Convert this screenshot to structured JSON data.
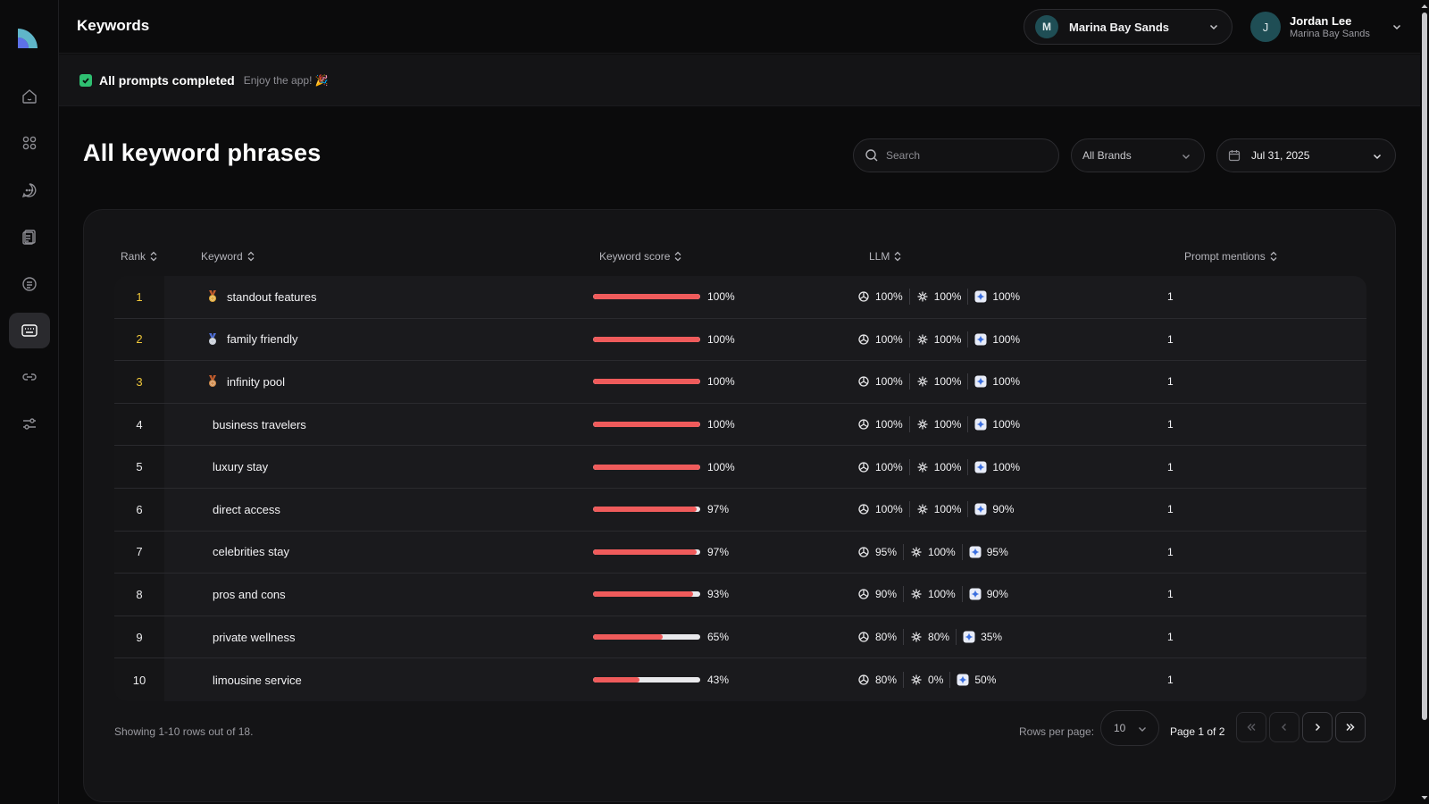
{
  "header": {
    "page_title": "Keywords",
    "brand": {
      "initial": "M",
      "name": "Marina Bay Sands"
    },
    "user": {
      "initial": "J",
      "name": "Jordan Lee",
      "org": "Marina Bay Sands"
    }
  },
  "banner": {
    "title": "All prompts completed",
    "subtitle": "Enjoy the app! 🎉"
  },
  "main": {
    "heading": "All keyword phrases",
    "search_placeholder": "Search",
    "brand_filter": "All Brands",
    "date_filter": "Jul 31, 2025"
  },
  "table": {
    "columns": {
      "rank": "Rank",
      "keyword": "Keyword",
      "score": "Keyword score",
      "llm": "LLM",
      "mentions": "Prompt mentions"
    },
    "rows": [
      {
        "rank": "1",
        "keyword": "standout features",
        "medal": "gold",
        "score": 100,
        "score_label": "100%",
        "llm": [
          "100%",
          "100%",
          "100%"
        ],
        "mentions": "1"
      },
      {
        "rank": "2",
        "keyword": "family friendly",
        "medal": "silver",
        "score": 100,
        "score_label": "100%",
        "llm": [
          "100%",
          "100%",
          "100%"
        ],
        "mentions": "1"
      },
      {
        "rank": "3",
        "keyword": "infinity pool",
        "medal": "bronze",
        "score": 100,
        "score_label": "100%",
        "llm": [
          "100%",
          "100%",
          "100%"
        ],
        "mentions": "1"
      },
      {
        "rank": "4",
        "keyword": "business travelers",
        "medal": "",
        "score": 100,
        "score_label": "100%",
        "llm": [
          "100%",
          "100%",
          "100%"
        ],
        "mentions": "1"
      },
      {
        "rank": "5",
        "keyword": "luxury stay",
        "medal": "",
        "score": 100,
        "score_label": "100%",
        "llm": [
          "100%",
          "100%",
          "100%"
        ],
        "mentions": "1"
      },
      {
        "rank": "6",
        "keyword": "direct access",
        "medal": "",
        "score": 97,
        "score_label": "97%",
        "llm": [
          "100%",
          "100%",
          "90%"
        ],
        "mentions": "1"
      },
      {
        "rank": "7",
        "keyword": "celebrities stay",
        "medal": "",
        "score": 97,
        "score_label": "97%",
        "llm": [
          "95%",
          "100%",
          "95%"
        ],
        "mentions": "1"
      },
      {
        "rank": "8",
        "keyword": "pros and cons",
        "medal": "",
        "score": 93,
        "score_label": "93%",
        "llm": [
          "90%",
          "100%",
          "90%"
        ],
        "mentions": "1"
      },
      {
        "rank": "9",
        "keyword": "private wellness",
        "medal": "",
        "score": 65,
        "score_label": "65%",
        "llm": [
          "80%",
          "80%",
          "35%"
        ],
        "mentions": "1"
      },
      {
        "rank": "10",
        "keyword": "limousine service",
        "medal": "",
        "score": 43,
        "score_label": "43%",
        "llm": [
          "80%",
          "0%",
          "50%"
        ],
        "mentions": "1"
      }
    ]
  },
  "footer": {
    "showing": "Showing 1-10 rows out of 18.",
    "rows_per_page_label": "Rows per page:",
    "rows_per_page": "10",
    "page_info": "Page 1 of 2"
  },
  "icons": {
    "llm": [
      "openai-icon",
      "claude-icon",
      "gemini-icon"
    ],
    "sidebar": [
      "home-icon",
      "grid-icon",
      "chat-icon",
      "documents-icon",
      "list-icon",
      "keywords-icon",
      "link-icon",
      "settings-sliders-icon"
    ]
  },
  "colors": {
    "accent": "#ef5b5b",
    "success": "#2fbf71",
    "rank_highlight": "#f0c73a",
    "background": "#0b0b0c"
  }
}
